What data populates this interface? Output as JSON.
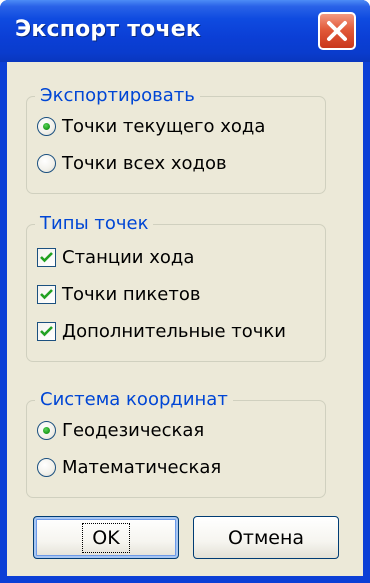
{
  "window": {
    "title": "Экспорт точек",
    "close_icon": "close-x-icon",
    "colors": {
      "titlebar": "#0b3fd6",
      "face": "#ece9d8",
      "group_label": "#0046d5",
      "close": "#e25a3a",
      "check": "#21a121"
    }
  },
  "export_group": {
    "legend": "Экспортировать",
    "options": [
      {
        "label": "Точки текущего хода",
        "checked": true
      },
      {
        "label": "Точки всех ходов",
        "checked": false
      }
    ]
  },
  "types_group": {
    "legend": "Типы точек",
    "items": [
      {
        "label": "Станции хода",
        "checked": true
      },
      {
        "label": "Точки пикетов",
        "checked": true
      },
      {
        "label": "Дополнительные точки",
        "checked": true
      }
    ]
  },
  "coords_group": {
    "legend": "Система координат",
    "options": [
      {
        "label": "Геодезическая",
        "checked": true
      },
      {
        "label": "Математическая",
        "checked": false
      }
    ]
  },
  "buttons": {
    "ok": "OK",
    "cancel": "Отмена"
  }
}
